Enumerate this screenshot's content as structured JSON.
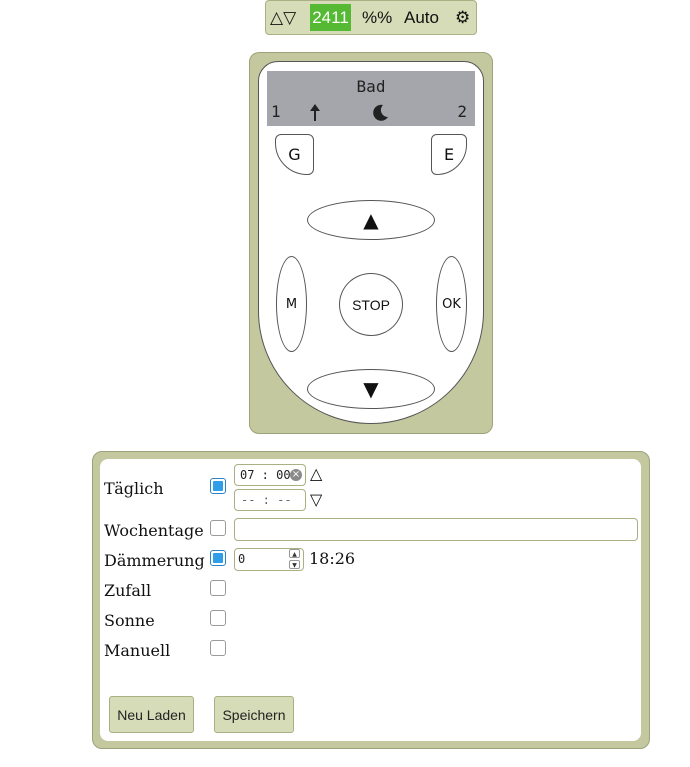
{
  "topbar": {
    "arrows": "△▽",
    "code": "2411",
    "percent": "%%",
    "mode": "Auto",
    "settings_icon": "gear-icon",
    "code_color": "#55b934"
  },
  "remote": {
    "display": {
      "name": "Bad",
      "left_number": "1",
      "right_number": "2",
      "arrow_icon": "arrow-up-icon",
      "moon_icon": "moon-icon"
    },
    "buttons": {
      "g": "G",
      "e": "E",
      "up": "▲",
      "down": "▼",
      "m": "M",
      "ok": "OK",
      "stop": "STOP"
    },
    "frame_color": "#c4c89e"
  },
  "timer": {
    "rows": {
      "daily": {
        "label": "Täglich",
        "checked": true
      },
      "weekdays": {
        "label": "Wochentage",
        "checked": false
      },
      "dusk": {
        "label": "Dämmerung",
        "checked": true
      },
      "random": {
        "label": "Zufall",
        "checked": false
      },
      "sun": {
        "label": "Sonne",
        "checked": false
      },
      "manual": {
        "label": "Manuell",
        "checked": false
      }
    },
    "daily_up_time": "07 : 00",
    "daily_down_time": "-- : --",
    "up_symbol": "△",
    "down_symbol": "▽",
    "weekdays_value": "",
    "dusk_offset": "0",
    "dusk_time": "18:26",
    "reload_label": "Neu Laden",
    "save_label": "Speichern"
  }
}
